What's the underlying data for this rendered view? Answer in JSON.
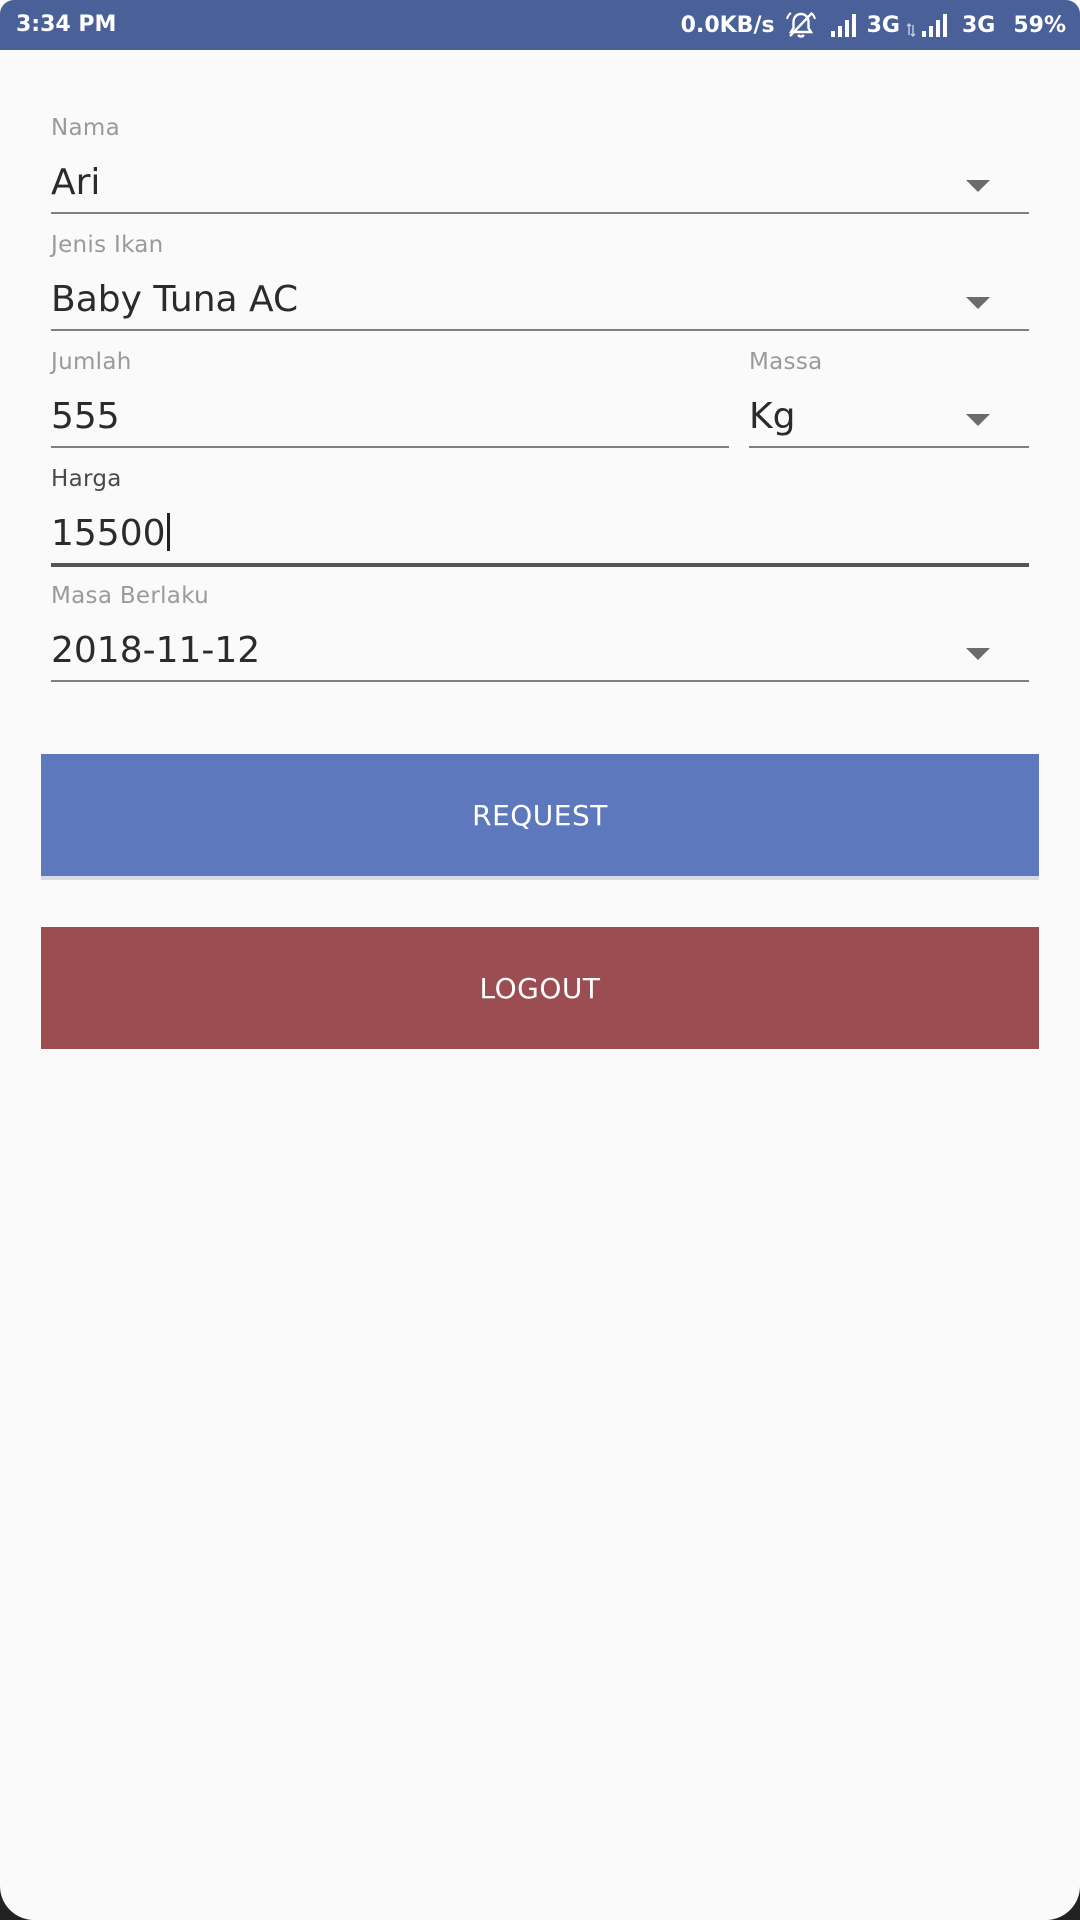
{
  "status_bar": {
    "time": "3:34 PM",
    "net_speed": "0.0KB/s",
    "network_1": "3G",
    "network_2": "3G",
    "battery": "59%",
    "icons": [
      "bell-muted-icon",
      "signal-icon",
      "data-arrows-icon",
      "signal-icon"
    ]
  },
  "form": {
    "nama": {
      "label": "Nama",
      "value": "Ari"
    },
    "jenis_ikan": {
      "label": "Jenis Ikan",
      "value": "Baby Tuna AC"
    },
    "jumlah": {
      "label": "Jumlah",
      "value": "555"
    },
    "massa": {
      "label": "Massa",
      "value": "Kg"
    },
    "harga": {
      "label": "Harga",
      "value": "15500"
    },
    "masa_berlaku": {
      "label": "Masa Berlaku",
      "value": "2018-11-12"
    }
  },
  "buttons": {
    "request": "REQUEST",
    "logout": "LOGOUT"
  },
  "colors": {
    "status_bar": "#4a6099",
    "request_button": "#5e78bd",
    "logout_button": "#9b4d52",
    "background": "#fafafa"
  }
}
